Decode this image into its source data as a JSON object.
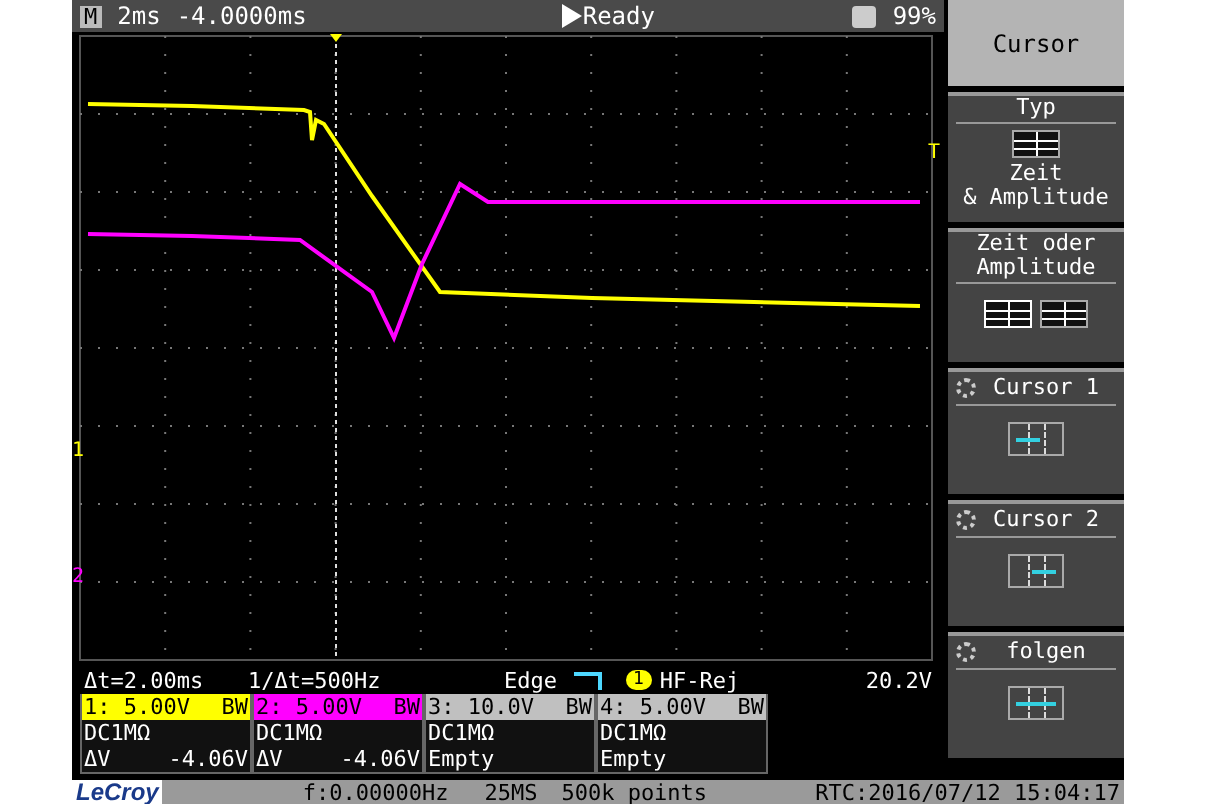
{
  "top_bar": {
    "mode_icon": "M",
    "timebase": "2ms",
    "delay": "-4.0000ms",
    "status": "Ready",
    "battery": "99%"
  },
  "markers": {
    "trigger_level": "T",
    "channel_1": "1",
    "channel_2": "2"
  },
  "info": {
    "delta_t": "Δt=2.00ms",
    "inverse_delta_t": "1/Δt=500Hz",
    "trigger_type": "Edge",
    "trigger_channel": "1",
    "trigger_filter": "HF-Rej",
    "trigger_level": "20.2V"
  },
  "channels": [
    {
      "label": "1: 5.00V",
      "bw": "BW",
      "color": "#ffff00",
      "coupling": "DC1MΩ",
      "measure_label": "ΔV",
      "measure_value": "-4.06V"
    },
    {
      "label": "2: 5.00V",
      "bw": "BW",
      "color": "#ff00ff",
      "coupling": "DC1MΩ",
      "measure_label": "ΔV",
      "measure_value": "-4.06V"
    },
    {
      "label": "3: 10.0V",
      "bw": "BW",
      "color": "#c0c0c0",
      "coupling": "DC1MΩ",
      "measure_label": "Empty"
    },
    {
      "label": "4: 5.00V",
      "bw": "BW",
      "color": "#c0c0c0",
      "coupling": "DC1MΩ",
      "measure_label": "Empty"
    }
  ],
  "menu": {
    "title": "Cursor",
    "items": [
      {
        "kind": "type",
        "label": "Typ",
        "caption": "Zeit\n& Amplitude"
      },
      {
        "kind": "choice",
        "label": "Zeit oder\nAmplitude"
      },
      {
        "kind": "leftcursor",
        "label": "Cursor 1"
      },
      {
        "kind": "rightcursor",
        "label": "Cursor 2"
      },
      {
        "kind": "follow",
        "label": "folgen"
      }
    ]
  },
  "status_bar": {
    "brand": "LeCroy",
    "frequency": "f:0.00000Hz",
    "sample_rate": "25MS",
    "points": "500k points",
    "clock": "RTC:2016/07/12 15:04:17"
  }
}
